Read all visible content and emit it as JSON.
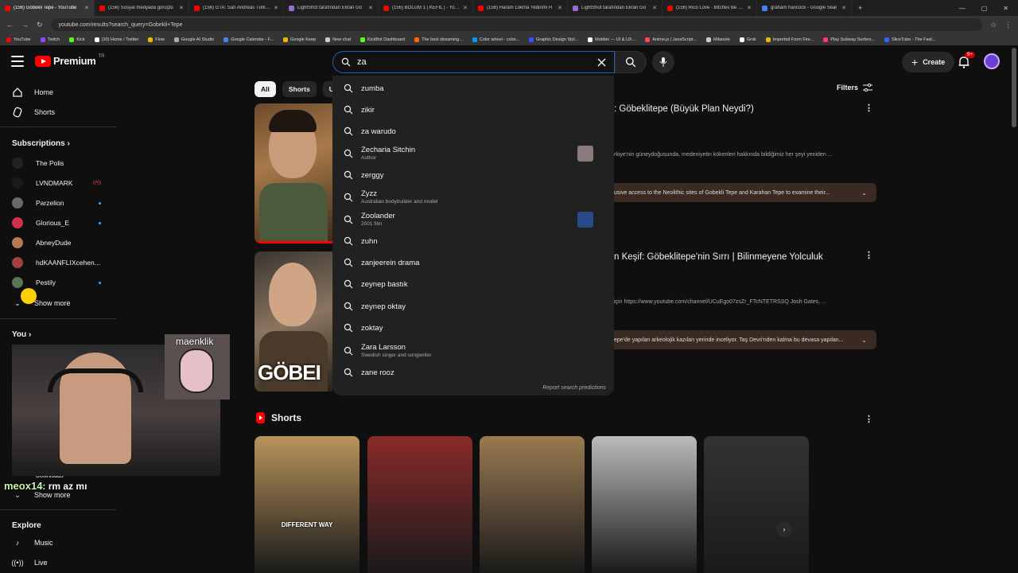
{
  "browser": {
    "tabs": [
      {
        "title": "(156) Göbekli Tepe - YouTube",
        "color": "#ff0000",
        "active": true
      },
      {
        "title": "(156) Sosyal medyada görüştü",
        "color": "#ff0000"
      },
      {
        "title": "(156) GTA: San Andreas Türkçe",
        "color": "#ff0000"
      },
      {
        "title": "LightShot tarafından Ekran Gö",
        "color": "#9b6cd4"
      },
      {
        "title": "(156) BÖLÜM 1 | KEFIL | - YouTu",
        "color": "#ff0000"
      },
      {
        "title": "(156) Haram Lokma Yedinmi H",
        "color": "#ff0000"
      },
      {
        "title": "LightShot tarafından Ekran Gö",
        "color": "#9b6cd4"
      },
      {
        "title": "(156) Rico Love - Bitches Be Lik",
        "color": "#ff0000"
      },
      {
        "title": "graham hancock - Google Sear",
        "color": "#4285f4"
      }
    ],
    "new_tab": "+",
    "url": "youtube.com/results?search_query=Gobekli+Tepe",
    "bookmarks": [
      {
        "label": "YouTube",
        "color": "#ff0000"
      },
      {
        "label": "Twitch",
        "color": "#9146ff"
      },
      {
        "label": "Kick",
        "color": "#53fc18"
      },
      {
        "label": "(10) Home / Twitter",
        "color": "#ffffff"
      },
      {
        "label": "Flow",
        "color": "#f4b400"
      },
      {
        "label": "Google AI Studio",
        "color": "#aaaaaa"
      },
      {
        "label": "Google Calendar - F...",
        "color": "#4285f4"
      },
      {
        "label": "Google Keep",
        "color": "#f4b400"
      },
      {
        "label": "New chat",
        "color": "#cccccc"
      },
      {
        "label": "KickBot Dashboard",
        "color": "#53fc18"
      },
      {
        "label": "The best streaming...",
        "color": "#ff6600"
      },
      {
        "label": "Color wheel - color...",
        "color": "#0099ff"
      },
      {
        "label": "Graphic Design Styl...",
        "color": "#3355ff"
      },
      {
        "label": "Mobbin — UI & UX...",
        "color": "#ffffff"
      },
      {
        "label": "Anime.js | JavaScript...",
        "color": "#ff4b4b"
      },
      {
        "label": "Milanote",
        "color": "#cccccc"
      },
      {
        "label": "Grok",
        "color": "#ffffff"
      },
      {
        "label": "Imported From Fire...",
        "color": "#f4b400"
      },
      {
        "label": "Play Subway Surfers...",
        "color": "#ff3366"
      },
      {
        "label": "SliceTube - The Fast...",
        "color": "#3366ff"
      }
    ]
  },
  "header": {
    "logo_word": "Premium",
    "logo_region": "TR",
    "search_value": "za",
    "create_label": "Create",
    "notification_count": "9+"
  },
  "sidebar": {
    "home": "Home",
    "shorts": "Shorts",
    "subscriptions_title": "Subscriptions",
    "subscriptions": [
      {
        "name": "The Polis",
        "color": "#222222",
        "indicator": ""
      },
      {
        "name": "LVNDMARK",
        "color": "#1a1a1a",
        "indicator": "live"
      },
      {
        "name": "Parzelion",
        "color": "#6a6a6a",
        "indicator": "dot"
      },
      {
        "name": "Glorious_E",
        "color": "#d03050",
        "indicator": "dot"
      },
      {
        "name": "AbneyDude",
        "color": "#b87a50",
        "indicator": ""
      },
      {
        "name": "hdKAANFLIXcehen...",
        "color": "#a04040",
        "indicator": ""
      },
      {
        "name": "Pestily",
        "color": "#557755",
        "indicator": "dot"
      }
    ],
    "show_more": "Show more",
    "you_title": "You",
    "downloads": "Downloads",
    "show_more_2": "Show more",
    "explore_title": "Explore",
    "music": "Music",
    "live": "Live"
  },
  "chips": [
    "All",
    "Shorts",
    "Unw"
  ],
  "filters_label": "Filters",
  "results": [
    {
      "title": ": Göbeklitepe (Büyük Plan Neydi?)",
      "desc": "rkiye'nin güneydoğusunda, medeniyetin kökenleri hakkında bildiğimiz her şeyi yeniden ...",
      "box": "usive access to the Neolithic sites of Gobekli Tepe and Karahan Tepe to examine their..."
    },
    {
      "title": "n Keşif: Göbeklitepe'nin Sırrı | Bilinmeyene Yolculuk",
      "desc": "için https://www.youtube.com/channel/UCuEgo07zsZr_FTcNTETRSSQ Josh Gates, ...",
      "box": "epe'de yapılan arkeolojik kazıları yerinde inceliyor. Taş Devri'nden kalma bu devasa yapılan..."
    }
  ],
  "thumb2_text": "GÖBEI",
  "suggestions": [
    {
      "text": "zumba",
      "sub": "",
      "pic": ""
    },
    {
      "text": "zikir",
      "sub": "",
      "pic": ""
    },
    {
      "text": "za warudo",
      "sub": "",
      "pic": ""
    },
    {
      "text": "Zecharia Sitchin",
      "sub": "Author",
      "pic": "#8a7a7a"
    },
    {
      "text": "zerggy",
      "sub": "",
      "pic": ""
    },
    {
      "text": "Zyzz",
      "sub": "Australian bodybuilder and model",
      "pic": ""
    },
    {
      "text": "Zoolander",
      "sub": "2001 film",
      "pic": "#2a4a8a"
    },
    {
      "text": "zuhn",
      "sub": "",
      "pic": ""
    },
    {
      "text": "zanjeerein drama",
      "sub": "",
      "pic": ""
    },
    {
      "text": "zeynep bastık",
      "sub": "",
      "pic": ""
    },
    {
      "text": "zeynep oktay",
      "sub": "",
      "pic": ""
    },
    {
      "text": "zoktay",
      "sub": "",
      "pic": ""
    },
    {
      "text": "Zara Larsson",
      "sub": "Swedish singer and songwriter",
      "pic": ""
    },
    {
      "text": "zane rooz",
      "sub": "",
      "pic": ""
    }
  ],
  "report_label": "Report search predictions",
  "shorts_section": {
    "title": "Shorts",
    "items": [
      {
        "bg": "#b8945a",
        "caption": "DIFFERENT WAY"
      },
      {
        "bg": "#8a2a2a",
        "caption": ""
      },
      {
        "bg": "#9a7a50",
        "caption": ""
      },
      {
        "bg": "#bbbbbb",
        "caption": ""
      },
      {
        "bg": "#333333",
        "caption": ""
      }
    ]
  },
  "stream_overlay": {
    "cam_label": "maenklik",
    "chat_user": "meox14",
    "chat_msg": ": rm az mı"
  }
}
